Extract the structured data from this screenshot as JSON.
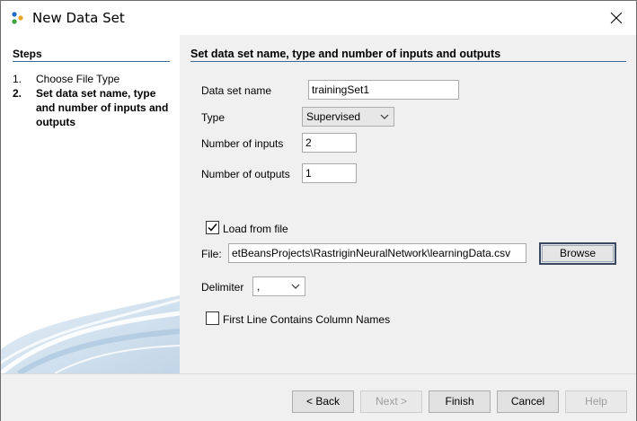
{
  "window": {
    "title": "New Data Set"
  },
  "steps": {
    "title": "Steps",
    "items": [
      {
        "num": "1.",
        "label": "Choose File Type"
      },
      {
        "num": "2.",
        "label": "Set data set name, type and number of inputs and outputs"
      }
    ]
  },
  "panel": {
    "title": "Set data set name, type and number of inputs and outputs",
    "dataset_name_label": "Data set name",
    "dataset_name_value": "trainingSet1",
    "type_label": "Type",
    "type_value": "Supervised",
    "inputs_label": "Number of inputs",
    "inputs_value": "2",
    "outputs_label": "Number of outputs",
    "outputs_value": "1",
    "load_from_file_label": "Load from file",
    "load_from_file_checked": true,
    "file_label": "File:",
    "file_value": "etBeansProjects\\RastriginNeuralNetwork\\learningData.csv",
    "browse_label": "Browse",
    "delimiter_label": "Delimiter",
    "delimiter_value": ",",
    "first_line_label": "First Line Contains Column Names",
    "first_line_checked": false
  },
  "footer": {
    "back": "< Back",
    "next": "Next >",
    "finish": "Finish",
    "cancel": "Cancel",
    "help": "Help"
  },
  "colors": {
    "accent_line": "#3d6a93",
    "focus_border": "#3b4a60"
  }
}
